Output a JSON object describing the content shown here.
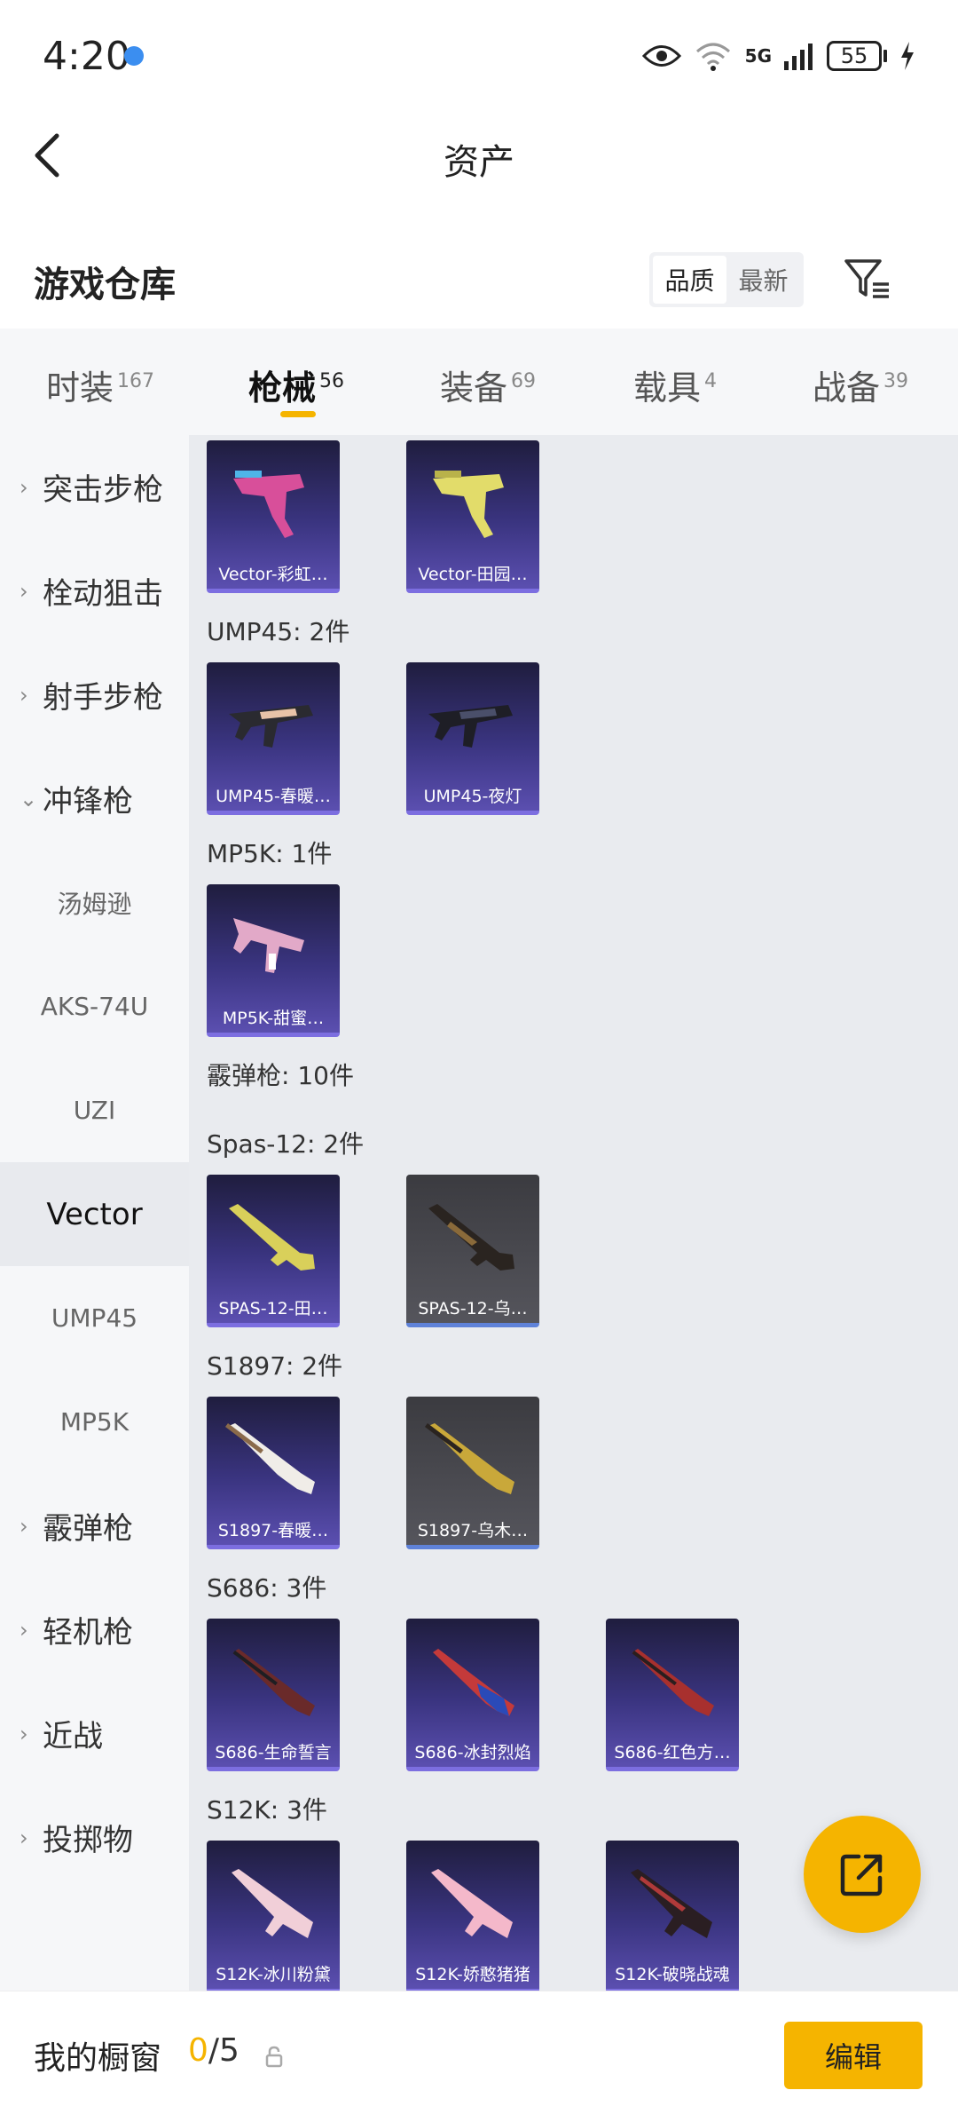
{
  "status_bar": {
    "time": "4:20",
    "network": "5G",
    "battery": "55"
  },
  "header": {
    "title": "资产"
  },
  "warehouse": {
    "title": "游戏仓库",
    "sort_options": [
      "品质",
      "最新"
    ]
  },
  "tabs": [
    {
      "label": "时装",
      "count": "167"
    },
    {
      "label": "枪械",
      "count": "56"
    },
    {
      "label": "装备",
      "count": "69"
    },
    {
      "label": "载具",
      "count": "4"
    },
    {
      "label": "战备",
      "count": "39"
    }
  ],
  "sidebar": {
    "items": [
      {
        "label": "突击步枪",
        "chevron": "›"
      },
      {
        "label": "栓动狙击",
        "chevron": "›"
      },
      {
        "label": "射手步枪",
        "chevron": "›"
      },
      {
        "label": "冲锋枪",
        "chevron": "⌄"
      },
      {
        "label": "汤姆逊"
      },
      {
        "label": "AKS-74U"
      },
      {
        "label": "UZI"
      },
      {
        "label": "Vector"
      },
      {
        "label": "UMP45"
      },
      {
        "label": "MP5K"
      },
      {
        "label": "霰弹枪",
        "chevron": "›"
      },
      {
        "label": "轻机枪",
        "chevron": "›"
      },
      {
        "label": "近战",
        "chevron": "›"
      },
      {
        "label": "投掷物",
        "chevron": "›"
      }
    ]
  },
  "content": {
    "labels": {
      "ump45": "UMP45: 2件",
      "mp5k": "MP5K: 1件",
      "shotgun": "霰弹枪: 10件",
      "spas12": "Spas-12: 2件",
      "s1897": "S1897: 2件",
      "s686": "S686: 3件",
      "s12k": "S12K: 3件"
    },
    "cards": {
      "vector_1": "Vector-彩虹…",
      "vector_2": "Vector-田园…",
      "ump45_1": "UMP45-春暖…",
      "ump45_2": "UMP45-夜灯",
      "mp5k_1": "MP5K-甜蜜…",
      "spas_1": "SPAS-12-田…",
      "spas_2": "SPAS-12-乌…",
      "s1897_1": "S1897-春暖…",
      "s1897_2": "S1897-乌木…",
      "s686_1": "S686-生命誓言",
      "s686_2": "S686-冰封烈焰",
      "s686_3": "S686-红色方…",
      "s12k_1": "S12K-冰川粉黛",
      "s12k_2": "S12K-娇憨猪猪",
      "s12k_3": "S12K-破晓战魂"
    }
  },
  "bottom_bar": {
    "label": "我的橱窗",
    "current": "0",
    "total": "/5",
    "edit": "编辑"
  },
  "colors": {
    "accent": "#f5b400",
    "card_purple": "#3a3480",
    "sidebar_bg": "#f6f7f9",
    "content_bg": "#e9ebef"
  },
  "icons": [
    "back-arrow-icon",
    "eye-icon",
    "wifi-icon",
    "signal-icon",
    "battery-icon",
    "charging-icon",
    "filter-icon",
    "share-icon",
    "lock-icon"
  ]
}
